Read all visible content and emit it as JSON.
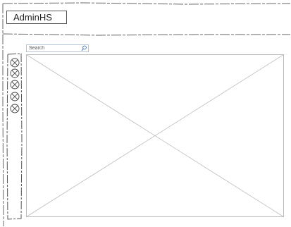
{
  "header": {
    "title": "AdminHS"
  },
  "search": {
    "placeholder": "Search",
    "icon": "search-icon"
  },
  "sidebar": {
    "items": [
      {
        "icon": "placeholder-icon"
      },
      {
        "icon": "placeholder-icon"
      },
      {
        "icon": "placeholder-icon"
      },
      {
        "icon": "placeholder-icon"
      },
      {
        "icon": "placeholder-icon"
      }
    ]
  },
  "content": {
    "type": "image-placeholder"
  },
  "colors": {
    "stroke": "#555555",
    "light_stroke": "#bbbbbb",
    "search_border": "#b6c4d8",
    "search_icon": "#3b6fb8"
  }
}
